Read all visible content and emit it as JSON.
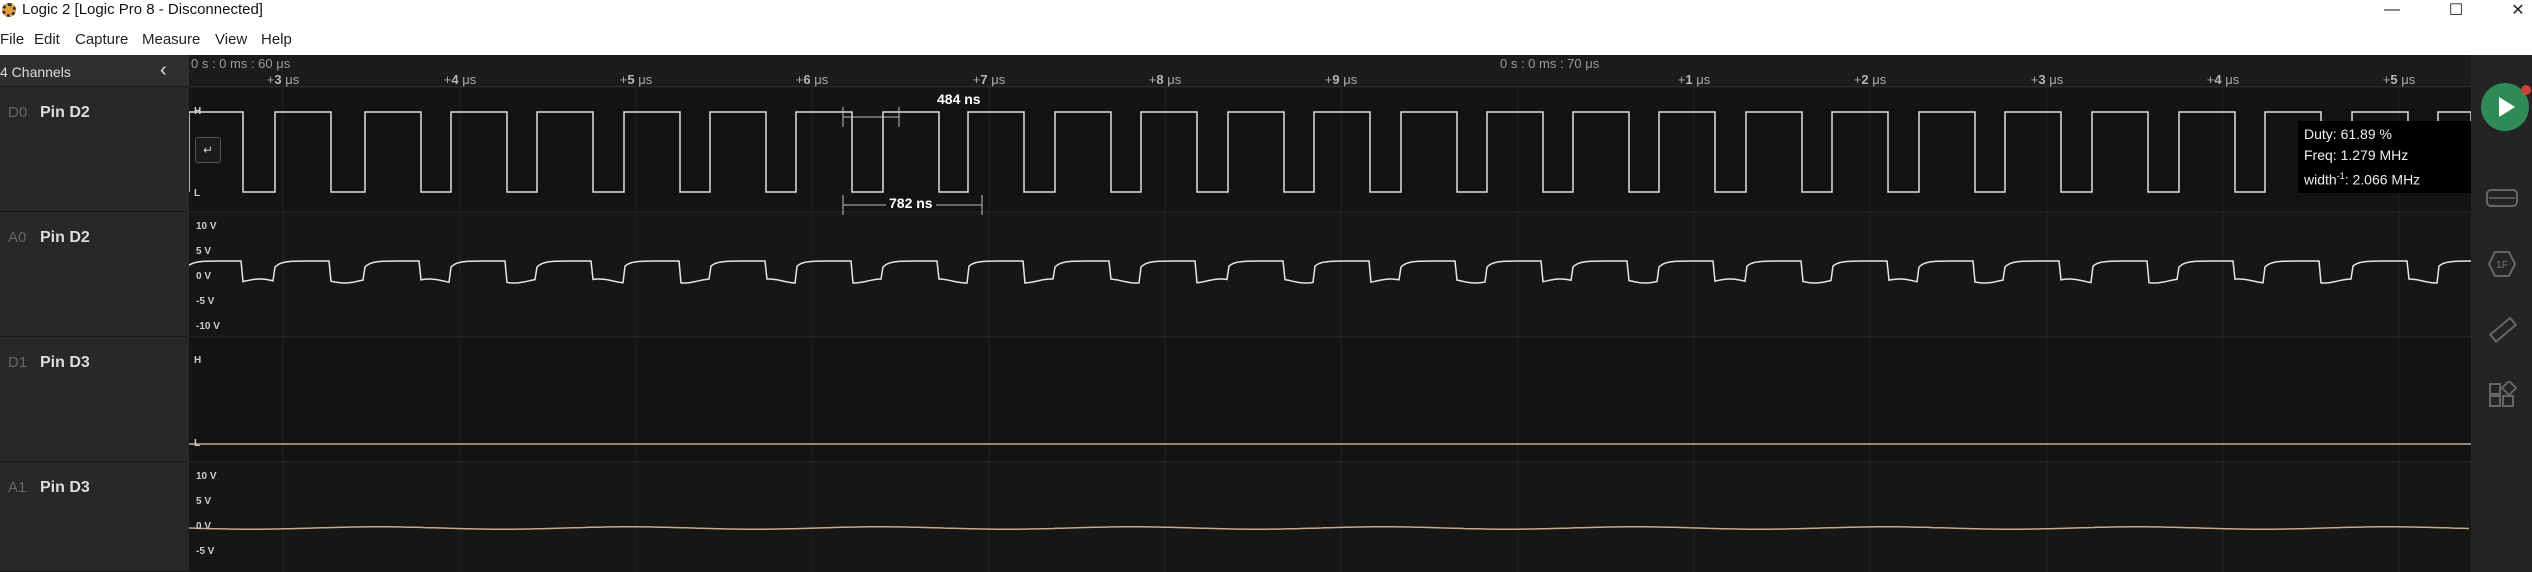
{
  "window": {
    "title": "Logic 2 [Logic Pro 8 - Disconnected]",
    "minimize_icon": "minimize-icon",
    "maximize_icon": "maximize-icon",
    "close_icon": "close-icon"
  },
  "menu": {
    "items": [
      "File",
      "Edit",
      "Capture",
      "Measure",
      "View",
      "Help"
    ]
  },
  "sidebar": {
    "channel_count": "4 Channels",
    "collapse_icon": "chevron-left-icon",
    "channels": [
      {
        "id": "D0",
        "name": "Pin D2"
      },
      {
        "id": "A0",
        "name": "Pin D2"
      },
      {
        "id": "D1",
        "name": "Pin D3"
      },
      {
        "id": "A1",
        "name": "Pin D3"
      }
    ]
  },
  "ruler": {
    "anchor_start": "0 s : 0 ms : 60 μs",
    "anchor_mid": "0 s : 0 ms : 70 μs",
    "ticks": [
      {
        "sign": "+",
        "num": "3",
        "unit": " μs"
      },
      {
        "sign": "+",
        "num": "4",
        "unit": " μs"
      },
      {
        "sign": "+",
        "num": "5",
        "unit": " μs"
      },
      {
        "sign": "+",
        "num": "6",
        "unit": " μs"
      },
      {
        "sign": "+",
        "num": "7",
        "unit": " μs"
      },
      {
        "sign": "+",
        "num": "8",
        "unit": " μs"
      },
      {
        "sign": "+",
        "num": "9",
        "unit": " μs"
      },
      {
        "sign": "+",
        "num": "1",
        "unit": " μs"
      },
      {
        "sign": "+",
        "num": "2",
        "unit": " μs"
      },
      {
        "sign": "+",
        "num": "3",
        "unit": " μs"
      },
      {
        "sign": "+",
        "num": "4",
        "unit": " μs"
      },
      {
        "sign": "+",
        "num": "5",
        "unit": " μs"
      }
    ]
  },
  "digital_labels": {
    "high": "H",
    "low": "L"
  },
  "analog_labels_a0": [
    "10 V",
    "5 V",
    "0 V",
    "-5 V",
    "-10 V"
  ],
  "analog_labels_a1": [
    "10 V",
    "5 V",
    "0 V",
    "-5 V"
  ],
  "measurements": {
    "pulse_width": "484 ns",
    "period": "782 ns",
    "duty": "Duty: 61.89 %",
    "freq": "Freq: 1.279 MHz",
    "width_inv": "width",
    "width_inv_sup": "-1",
    "width_inv_value": ": 2.066 MHz"
  },
  "trigger_icons": [
    "falling-edge-trigger-icon",
    "pulse-measure-icon"
  ],
  "right_bar": {
    "play_icon": "play-icon",
    "icons": [
      "hardware-icon",
      "analyzer-icon",
      "ruler-icon",
      "extensions-icon"
    ],
    "analyzer_text": "1F"
  },
  "colors": {
    "digital_trace": "#e0e0e0",
    "analog_a0": "#e6e6e6",
    "analog_a1": "#c9aa88",
    "d1_trace": "#c9aa88",
    "play": "#2e8b57"
  }
}
